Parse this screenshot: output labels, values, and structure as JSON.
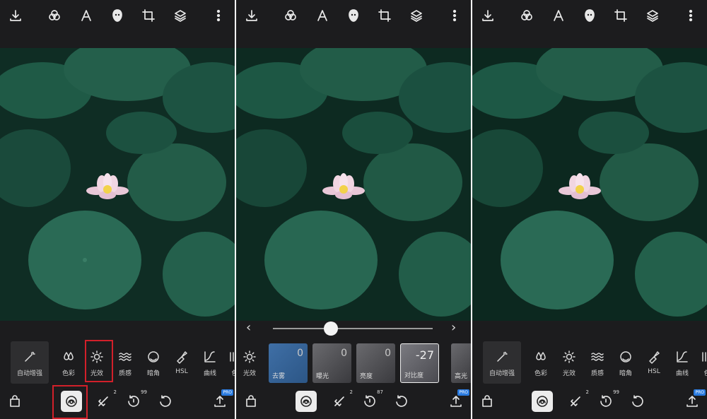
{
  "panels": [
    {
      "tools": [
        "自动增强",
        "色彩",
        "光效",
        "质感",
        "暗角",
        "HSL",
        "曲线",
        "色"
      ],
      "top_icons": [
        "download-icon",
        "filters-icon",
        "text-icon",
        "face-icon",
        "crop-icon",
        "layers-icon",
        "more-icon"
      ]
    },
    {
      "slider": {
        "left_arrow": "‹",
        "right_arrow": "›"
      },
      "tools_left": {
        "label": "光效"
      },
      "cards": [
        {
          "label": "去雾",
          "value": "0"
        },
        {
          "label": "曝光",
          "value": "0"
        },
        {
          "label": "亮度",
          "value": "0"
        },
        {
          "label": "对比度",
          "value": "-27"
        },
        {
          "label": "高光",
          "value": ""
        }
      ]
    },
    {
      "tools": [
        "自动增强",
        "色彩",
        "光效",
        "质感",
        "暗角",
        "HSL",
        "曲线",
        "色"
      ]
    }
  ],
  "bottom": {
    "badge_2": "2",
    "badge_99": "99",
    "badge_87": "87",
    "pro_label": "PRO"
  },
  "colors": {
    "highlight": "#d2202a",
    "pro_badge": "#2a7be0",
    "background": "#1c1c1e"
  }
}
